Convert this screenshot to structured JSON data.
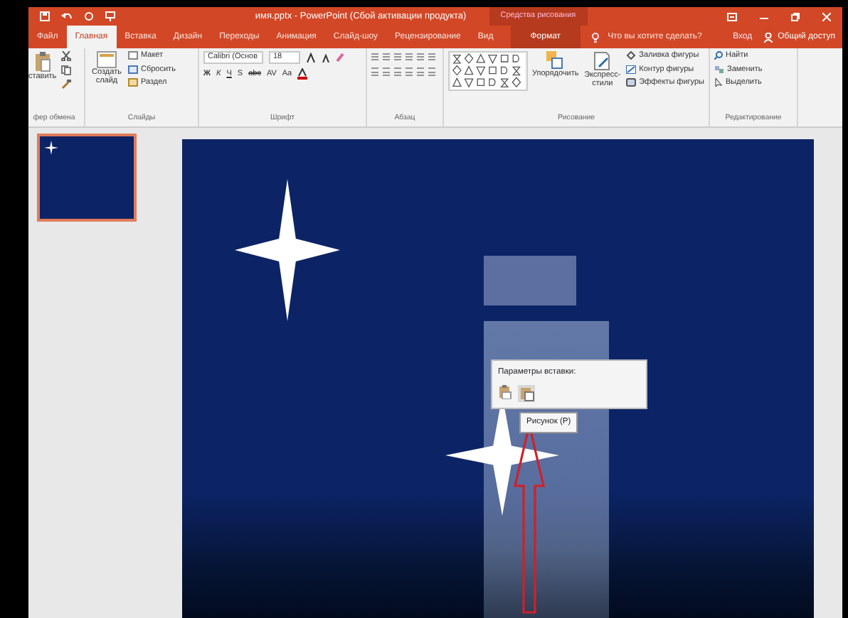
{
  "window": {
    "title": "имя.pptx - PowerPoint (Сбой активации продукта)",
    "context_group": "Средства рисования"
  },
  "tabs": [
    {
      "label": "Файл",
      "selected": false,
      "kind": "file"
    },
    {
      "label": "Главная",
      "selected": true,
      "kind": "tab"
    },
    {
      "label": "Вставка",
      "selected": false,
      "kind": "tab"
    },
    {
      "label": "Дизайн",
      "selected": false,
      "kind": "tab"
    },
    {
      "label": "Переходы",
      "selected": false,
      "kind": "tab"
    },
    {
      "label": "Анимация",
      "selected": false,
      "kind": "tab"
    },
    {
      "label": "Слайд-шоу",
      "selected": false,
      "kind": "tab"
    },
    {
      "label": "Рецензирование",
      "selected": false,
      "kind": "tab"
    },
    {
      "label": "Вид",
      "selected": false,
      "kind": "tab"
    },
    {
      "label": "Формат",
      "selected": false,
      "kind": "context"
    }
  ],
  "tell_me": {
    "placeholder": "Что вы хотите сделать?"
  },
  "sign_in": "Вход",
  "share": "Общий доступ",
  "ribbon": {
    "clipboard": {
      "paste": "ставить",
      "label": "фер обмена"
    },
    "slides": {
      "new_slide": "Создать слайд",
      "layout": "Макет",
      "reset": "Сбросить",
      "section": "Раздел",
      "label": "Слайды"
    },
    "font": {
      "name": "Calibri (Основ",
      "size": "18",
      "format_buttons": [
        "Ж",
        "К",
        "Ч",
        "S",
        "abc",
        "AV",
        "Aa"
      ],
      "label": "Шрифт"
    },
    "paragraph": {
      "label": "Абзац"
    },
    "drawing": {
      "arrange": "Упорядочить",
      "quick_styles": "Экспресс-стили",
      "fill": "Заливка фигуры",
      "outline": "Контур фигуры",
      "effects": "Эффекты фигуры",
      "label": "Рисование"
    },
    "editing": {
      "find": "Найти",
      "replace": "Заменить",
      "select": "Выделить",
      "label": "Редактирование"
    }
  },
  "paste_options": {
    "title": "Параметры вставки:",
    "tooltip": "Рисунок (P)"
  }
}
